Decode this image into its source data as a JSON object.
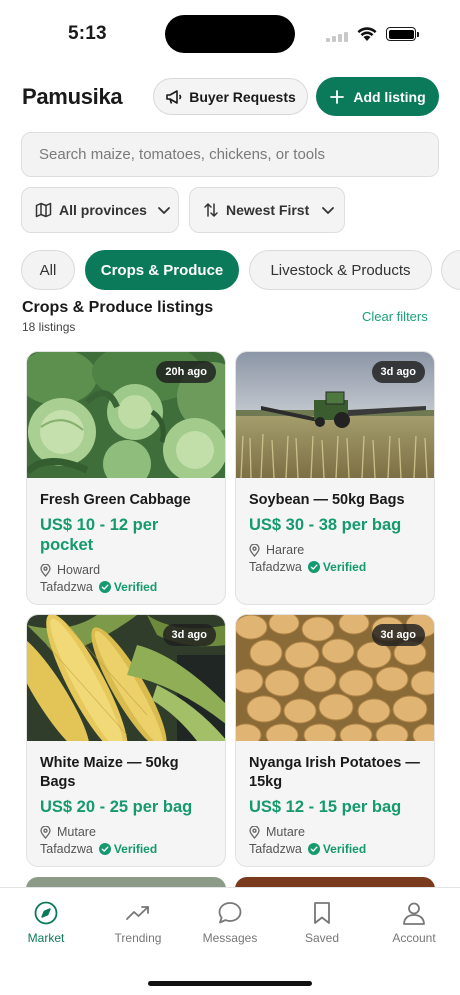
{
  "status_bar": {
    "time": "5:13"
  },
  "header": {
    "title": "Pamusika",
    "buyer_requests_label": "Buyer Requests",
    "add_listing_label": "Add listing"
  },
  "search": {
    "placeholder": "Search maize, tomatoes, chickens, or tools",
    "value": ""
  },
  "filters": {
    "province_label": "All provinces",
    "sort_label": "Newest First"
  },
  "categories": [
    {
      "label": "All",
      "active": false
    },
    {
      "label": "Crops & Produce",
      "active": true
    },
    {
      "label": "Livestock & Products",
      "active": false
    }
  ],
  "section": {
    "title": "Crops & Produce listings",
    "count": "18 listings",
    "clear_filters": "Clear filters"
  },
  "listings": [
    {
      "name": "Fresh Green Cabbage",
      "price": "US$ 10 - 12 per pocket",
      "age": "20h ago",
      "location": "Howard",
      "seller": "Tafadzwa",
      "verified_label": "Verified",
      "image": "cabbage"
    },
    {
      "name": "Soybean — 50kg Bags",
      "price": "US$ 30 - 38 per bag",
      "age": "3d ago",
      "location": "Harare",
      "seller": "Tafadzwa",
      "verified_label": "Verified",
      "image": "tractor-field"
    },
    {
      "name": "White Maize — 50kg Bags",
      "price": "US$ 20 - 25 per bag",
      "age": "3d ago",
      "location": "Mutare",
      "seller": "Tafadzwa",
      "verified_label": "Verified",
      "image": "maize-cobs"
    },
    {
      "name": "Nyanga Irish Potatoes — 15kg",
      "price": "US$ 12 - 15 per bag",
      "age": "3d ago",
      "location": "Mutare",
      "seller": "Tafadzwa",
      "verified_label": "Verified",
      "image": "potatoes"
    }
  ],
  "bottom_nav": [
    {
      "label": "Market",
      "icon": "compass-icon",
      "active": true
    },
    {
      "label": "Trending",
      "icon": "trending-icon",
      "active": false
    },
    {
      "label": "Messages",
      "icon": "chat-bubble-icon",
      "active": false
    },
    {
      "label": "Saved",
      "icon": "bookmark-icon",
      "active": false
    },
    {
      "label": "Account",
      "icon": "person-icon",
      "active": false
    }
  ],
  "colors": {
    "accent": "#0b7a5a",
    "price": "#149a6e",
    "link": "#1aa07a"
  }
}
